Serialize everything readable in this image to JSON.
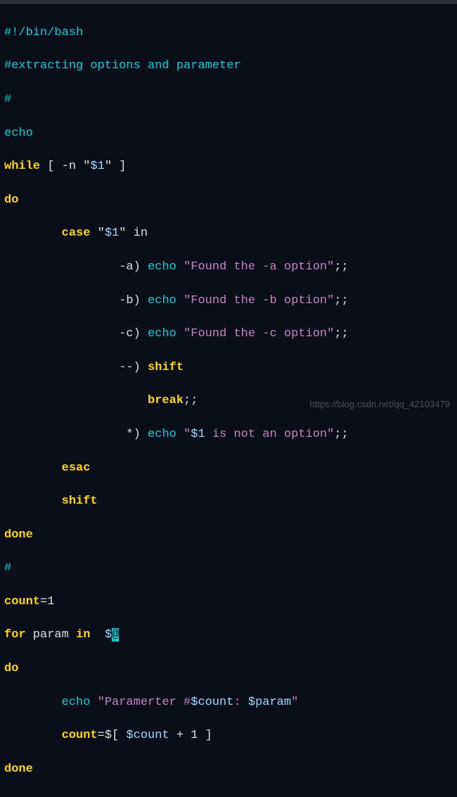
{
  "code": {
    "l1_shebang": "#!/bin/bash",
    "l2_comment": "#extracting options and parameter",
    "l3_hash": "#",
    "l4_echo": "echo",
    "l5_while": "while",
    "l5_cond": " [ -n \"",
    "l5_var": "$1",
    "l5_cond2": "\" ]",
    "l6_do": "do",
    "l7_case": "        case",
    "l7_case_arg": " \"",
    "l7_var": "$1",
    "l7_case_arg2": "\" in",
    "l8a_pat": "                -a) ",
    "l8a_echo": "echo",
    "l8a_sp": " ",
    "l8a_str": "\"Found the -a option\"",
    "l8a_end": ";;",
    "l8b_pat": "                -b) ",
    "l8b_echo": "echo",
    "l8b_str": "\"Found the -b option\"",
    "l8b_end": ";;",
    "l8c_pat": "                -c) ",
    "l8c_echo": "echo",
    "l8c_str": "\"Found the -c option\"",
    "l8c_end": ";;",
    "l9_pat": "                --) ",
    "l9_shift": "shift",
    "l10_break": "                    break",
    "l10_end": ";;",
    "l11_pat": "                 *) ",
    "l11_echo": "echo",
    "l11_str1": "\"",
    "l11_var": "$1",
    "l11_str2": " is not an option\"",
    "l11_end": ";;",
    "l12_esac": "        esac",
    "l13_shift": "        shift",
    "l14_done": "done",
    "l15_hash": "#",
    "l16_count": "count",
    "l16_eq": "=1",
    "l17_for": "for",
    "l17_param": " param ",
    "l17_in": "in",
    "l17_sp": "  ",
    "l17_var": "$",
    "l17_cursor": "@",
    "l18_do": "do",
    "l19_echo": "        echo",
    "l19_str1": " \"Paramerter #",
    "l19_var1": "$count",
    "l19_str2": ": ",
    "l19_var2": "$param",
    "l19_str3": "\"",
    "l20_count": "        count",
    "l20_eq": "=",
    "l20_expr1": "$[ ",
    "l20_var": "$count",
    "l20_expr2": " + 1 ]",
    "l21_done": "done"
  },
  "watermark": "https://blog.csdn.net/qq_42103479"
}
